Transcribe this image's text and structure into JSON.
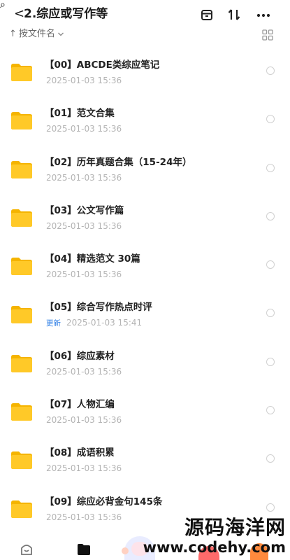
{
  "header": {
    "back_glyph": "<",
    "title": "2.综应或写作等"
  },
  "sort": {
    "label": "按文件名"
  },
  "files": [
    {
      "name": "【00】ABCDE类综应笔记",
      "date": "2025-01-03 15:36",
      "badge": ""
    },
    {
      "name": "【01】范文合集",
      "date": "2025-01-03 15:36",
      "badge": ""
    },
    {
      "name": "【02】历年真题合集（15-24年）",
      "date": "2025-01-03 15:36",
      "badge": ""
    },
    {
      "name": "【03】公文写作篇",
      "date": "2025-01-03 15:36",
      "badge": ""
    },
    {
      "name": "【04】精选范文 30篇",
      "date": "2025-01-03 15:36",
      "badge": ""
    },
    {
      "name": "【05】综合写作热点时评",
      "date": "2025-01-03 15:41",
      "badge": "更新"
    },
    {
      "name": "【06】综应素材",
      "date": "2025-01-03 15:36",
      "badge": ""
    },
    {
      "name": "【07】人物汇编",
      "date": "2025-01-03 15:36",
      "badge": ""
    },
    {
      "name": "【08】成语积累",
      "date": "2025-01-03 15:36",
      "badge": ""
    },
    {
      "name": "【09】综应必背金句145条",
      "date": "2025-01-03 15:36",
      "badge": ""
    }
  ],
  "watermark": {
    "line1": "源码海洋网",
    "line2": "www.codehy.com"
  },
  "colors": {
    "folder": "#ffc928",
    "folder_tab": "#f5b400",
    "accent_blue": "#2f7fe6"
  },
  "icons": [
    "cursor-icon",
    "back-icon",
    "save-icon",
    "sort-icon",
    "more-icon",
    "grid-view-icon",
    "folder-icon",
    "select-radio-icon",
    "home-tab-icon",
    "files-tab-icon",
    "avatar-icon"
  ]
}
